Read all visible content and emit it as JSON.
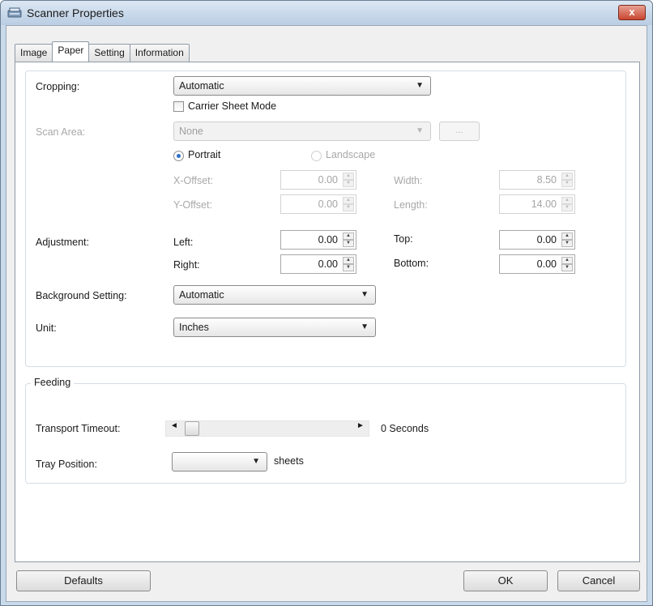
{
  "window": {
    "title": "Scanner Properties",
    "close_label": "x"
  },
  "tabs": [
    {
      "label": "Image",
      "active": false
    },
    {
      "label": "Paper",
      "active": true
    },
    {
      "label": "Setting",
      "active": false
    },
    {
      "label": "Information",
      "active": false
    }
  ],
  "cropping": {
    "label": "Cropping:",
    "value": "Automatic",
    "carrier_sheet_label": "Carrier Sheet Mode",
    "carrier_sheet_checked": false
  },
  "scan_area": {
    "label": "Scan Area:",
    "value": "None",
    "more_button": "...",
    "portrait_label": "Portrait",
    "landscape_label": "Landscape",
    "x_offset_label": "X-Offset:",
    "x_offset": "0.00",
    "y_offset_label": "Y-Offset:",
    "y_offset": "0.00",
    "width_label": "Width:",
    "width": "8.50",
    "length_label": "Length:",
    "length": "14.00"
  },
  "adjustment": {
    "label": "Adjustment:",
    "left_label": "Left:",
    "left": "0.00",
    "right_label": "Right:",
    "right": "0.00",
    "top_label": "Top:",
    "top": "0.00",
    "bottom_label": "Bottom:",
    "bottom": "0.00"
  },
  "background": {
    "label": "Background Setting:",
    "value": "Automatic"
  },
  "unit": {
    "label": "Unit:",
    "value": "Inches"
  },
  "feeding": {
    "legend": "Feeding",
    "transport_label": "Transport Timeout:",
    "transport_value": "0 Seconds",
    "transport_level": 0,
    "tray_label": "Tray Position:",
    "tray_value": "",
    "tray_unit": "sheets"
  },
  "buttons": {
    "defaults": "Defaults",
    "ok": "OK",
    "cancel": "Cancel"
  }
}
